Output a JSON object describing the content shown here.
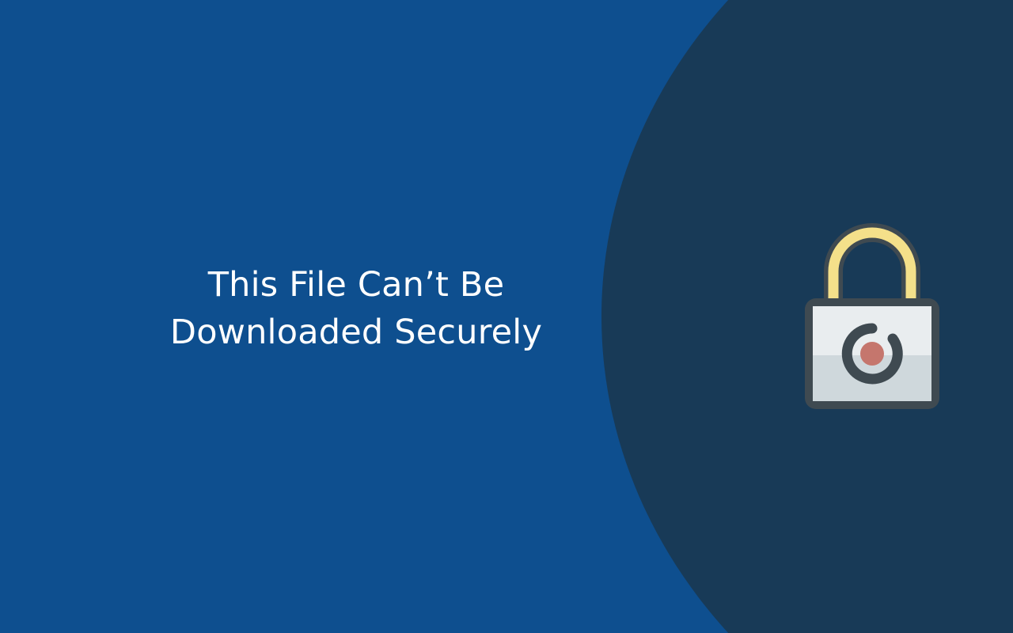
{
  "headline": {
    "line1": "This File Can’t Be",
    "line2": "Downloaded Securely"
  },
  "colors": {
    "bg_primary": "#0e4f8f",
    "bg_shape": "#183a57",
    "lock_outline": "#3f4a51",
    "lock_shackle": "#f4e08a",
    "lock_body_top": "#e9edef",
    "lock_body_bottom": "#cfd8dc",
    "lock_center_ring": "#3f4a51",
    "lock_center_dot": "#c5766d"
  },
  "icon": {
    "name": "padlock-icon"
  }
}
